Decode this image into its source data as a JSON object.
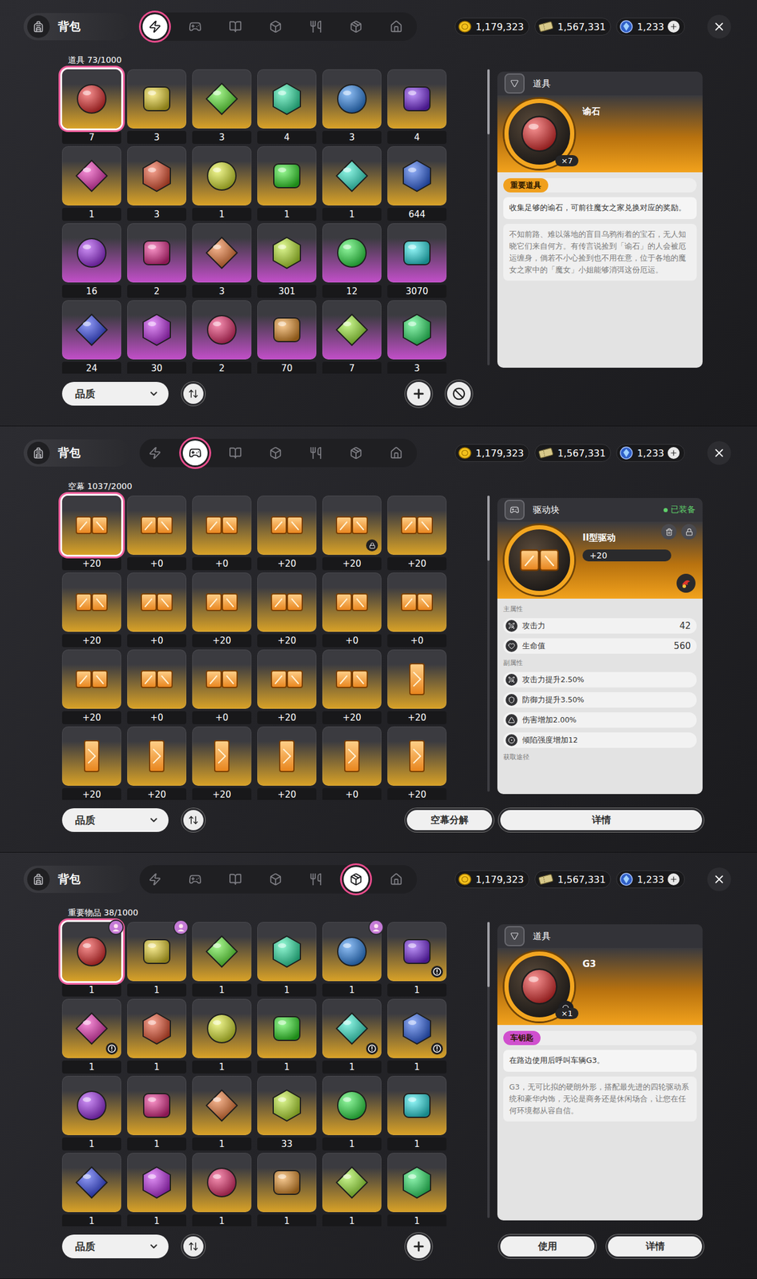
{
  "panels": [
    {
      "header": {
        "title": "背包"
      },
      "tabs": [
        {
          "selected": true
        },
        {
          "selected": false
        },
        {
          "selected": false
        },
        {
          "selected": false
        },
        {
          "selected": false
        },
        {
          "selected": false
        },
        {
          "selected": false
        }
      ],
      "currencies": [
        {
          "amount": "1,179,323",
          "addable": false
        },
        {
          "amount": "1,567,331",
          "addable": false
        },
        {
          "amount": "1,233",
          "addable": true
        }
      ],
      "inventory": {
        "label": "道具 73/1000",
        "items": [
          {
            "count": "7",
            "color": "#d9a227",
            "selected": true
          },
          {
            "count": "3",
            "color": "#d9a227",
            "selected": false
          },
          {
            "count": "3",
            "color": "#d9a227",
            "selected": false
          },
          {
            "count": "4",
            "color": "#d9a227",
            "selected": false
          },
          {
            "count": "3",
            "color": "#d9a227",
            "selected": false
          },
          {
            "count": "4",
            "color": "#d9a227",
            "selected": false
          },
          {
            "count": "1",
            "color": "#d9a227",
            "selected": false
          },
          {
            "count": "3",
            "color": "#d9a227",
            "selected": false
          },
          {
            "count": "1",
            "color": "#d9a227",
            "selected": false
          },
          {
            "count": "1",
            "color": "#d9a227",
            "selected": false
          },
          {
            "count": "1",
            "color": "#d9a227",
            "selected": false
          },
          {
            "count": "644",
            "color": "#d9a227",
            "selected": false
          },
          {
            "count": "16",
            "color": "#c24fc9",
            "selected": false
          },
          {
            "count": "2",
            "color": "#c24fc9",
            "selected": false
          },
          {
            "count": "3",
            "color": "#c24fc9",
            "selected": false
          },
          {
            "count": "301",
            "color": "#c24fc9",
            "selected": false
          },
          {
            "count": "12",
            "color": "#c24fc9",
            "selected": false
          },
          {
            "count": "3070",
            "color": "#c24fc9",
            "selected": false
          },
          {
            "count": "24",
            "color": "#c24fc9",
            "selected": false
          },
          {
            "count": "30",
            "color": "#c24fc9",
            "selected": false
          },
          {
            "count": "2",
            "color": "#c24fc9",
            "selected": false
          },
          {
            "count": "70",
            "color": "#c24fc9",
            "selected": false
          },
          {
            "count": "7",
            "color": "#c24fc9",
            "selected": false
          },
          {
            "count": "3",
            "color": "#c24fc9",
            "selected": false
          }
        ]
      },
      "detail": {
        "kind": "item",
        "category": "道具",
        "name": "谕石",
        "quantity": "×7",
        "tag": "重要道具",
        "tag_color": "#f0a01e",
        "searchable": false,
        "description": "收集足够的谕石，可前往魔女之家兑换对应的奖励。",
        "lore": "不知前路、难以落地的盲目乌鸦衔着的宝石，无人知晓它们来自何方。有传言说捡到「谕石」的人会被厄运缠身，倘若不小心捡到也不用在意，位于各地的魔女之家中的「魔女」小姐能够消弭这份厄运。"
      },
      "bottom": {
        "quality_filter": "品质",
        "tools": [
          {
            "kind": "add"
          },
          {
            "kind": "clear"
          }
        ],
        "buttons": []
      }
    },
    {
      "header": {
        "title": "背包"
      },
      "tabs": [
        {
          "selected": false
        },
        {
          "selected": true
        },
        {
          "selected": false
        },
        {
          "selected": false
        },
        {
          "selected": false
        },
        {
          "selected": false
        },
        {
          "selected": false
        }
      ],
      "currencies": [
        {
          "amount": "1,179,323",
          "addable": false
        },
        {
          "amount": "1,567,331",
          "addable": false
        },
        {
          "amount": "1,233",
          "addable": true
        }
      ],
      "inventory": {
        "label": "空幕 1037/2000",
        "items": [
          {
            "count": "+20",
            "color": "#d9a227",
            "selected": true,
            "kind": "wide",
            "locked": false
          },
          {
            "count": "+0",
            "color": "#d9a227",
            "selected": false,
            "kind": "wide",
            "locked": false
          },
          {
            "count": "+0",
            "color": "#d9a227",
            "selected": false,
            "kind": "wide",
            "locked": false
          },
          {
            "count": "+20",
            "color": "#d9a227",
            "selected": false,
            "kind": "wide",
            "locked": false
          },
          {
            "count": "+20",
            "color": "#d9a227",
            "selected": false,
            "kind": "wide",
            "locked": true
          },
          {
            "count": "+20",
            "color": "#d9a227",
            "selected": false,
            "kind": "wide",
            "locked": false
          },
          {
            "count": "+20",
            "color": "#d9a227",
            "selected": false,
            "kind": "wide",
            "locked": false
          },
          {
            "count": "+0",
            "color": "#d9a227",
            "selected": false,
            "kind": "wide",
            "locked": false
          },
          {
            "count": "+20",
            "color": "#d9a227",
            "selected": false,
            "kind": "wide",
            "locked": false
          },
          {
            "count": "+20",
            "color": "#d9a227",
            "selected": false,
            "kind": "wide",
            "locked": false
          },
          {
            "count": "+0",
            "color": "#d9a227",
            "selected": false,
            "kind": "wide",
            "locked": false
          },
          {
            "count": "+0",
            "color": "#d9a227",
            "selected": false,
            "kind": "wide",
            "locked": false
          },
          {
            "count": "+20",
            "color": "#d9a227",
            "selected": false,
            "kind": "wide",
            "locked": false
          },
          {
            "count": "+0",
            "color": "#d9a227",
            "selected": false,
            "kind": "wide",
            "locked": false
          },
          {
            "count": "+0",
            "color": "#d9a227",
            "selected": false,
            "kind": "wide",
            "locked": false
          },
          {
            "count": "+20",
            "color": "#d9a227",
            "selected": false,
            "kind": "wide",
            "locked": false
          },
          {
            "count": "+20",
            "color": "#d9a227",
            "selected": false,
            "kind": "wide",
            "locked": false
          },
          {
            "count": "+20",
            "color": "#d9a227",
            "selected": false,
            "kind": "tall",
            "locked": false
          },
          {
            "count": "+20",
            "color": "#d9a227",
            "selected": false,
            "kind": "tall",
            "locked": false
          },
          {
            "count": "+20",
            "color": "#d9a227",
            "selected": false,
            "kind": "tall",
            "locked": false
          },
          {
            "count": "+20",
            "color": "#d9a227",
            "selected": false,
            "kind": "tall",
            "locked": false
          },
          {
            "count": "+20",
            "color": "#d9a227",
            "selected": false,
            "kind": "tall",
            "locked": false
          },
          {
            "count": "+0",
            "color": "#d9a227",
            "selected": false,
            "kind": "tall",
            "locked": false
          },
          {
            "count": "+20",
            "color": "#d9a227",
            "selected": false,
            "kind": "tall",
            "locked": false
          }
        ]
      },
      "detail": {
        "kind": "disc",
        "category": "驱动块",
        "status": "已装备",
        "name": "II型驱动",
        "level": "+20",
        "main_label": "主属性",
        "main_stats": [
          {
            "label": "攻击力",
            "value": "42"
          },
          {
            "label": "生命值",
            "value": "560"
          }
        ],
        "sub_label": "副属性",
        "sub_stats": [
          {
            "label": "攻击力提升2.50%"
          },
          {
            "label": "防御力提升3.50%"
          },
          {
            "label": "伤害增加2.00%"
          },
          {
            "label": "倾陷强度增加12"
          }
        ],
        "source_label": "获取途径"
      },
      "bottom": {
        "quality_filter": "品质",
        "tools": [
          {
            "kind": "text",
            "label": "空幕分解"
          }
        ],
        "buttons": [
          "详情"
        ]
      }
    },
    {
      "header": {
        "title": "背包"
      },
      "tabs": [
        {
          "selected": false
        },
        {
          "selected": false
        },
        {
          "selected": false
        },
        {
          "selected": false
        },
        {
          "selected": false
        },
        {
          "selected": true
        },
        {
          "selected": false
        }
      ],
      "currencies": [
        {
          "amount": "1,179,323",
          "addable": false
        },
        {
          "amount": "1,567,331",
          "addable": false
        },
        {
          "amount": "1,233",
          "addable": true
        }
      ],
      "inventory": {
        "label": "重要物品 38/1000",
        "items": [
          {
            "count": "1",
            "color": "#d9a227",
            "selected": true,
            "badge": "avatar"
          },
          {
            "count": "1",
            "color": "#d9a227",
            "selected": false,
            "badge": "avatar"
          },
          {
            "count": "1",
            "color": "#d9a227",
            "selected": false,
            "badge": "none"
          },
          {
            "count": "1",
            "color": "#d9a227",
            "selected": false,
            "badge": "none"
          },
          {
            "count": "1",
            "color": "#d9a227",
            "selected": false,
            "badge": "avatar"
          },
          {
            "count": "1",
            "color": "#d9a227",
            "selected": false,
            "badge": "alert"
          },
          {
            "count": "1",
            "color": "#d9a227",
            "selected": false,
            "badge": "alert"
          },
          {
            "count": "1",
            "color": "#d9a227",
            "selected": false,
            "badge": "none"
          },
          {
            "count": "1",
            "color": "#d9a227",
            "selected": false,
            "badge": "none"
          },
          {
            "count": "1",
            "color": "#d9a227",
            "selected": false,
            "badge": "none"
          },
          {
            "count": "1",
            "color": "#d9a227",
            "selected": false,
            "badge": "alert"
          },
          {
            "count": "1",
            "color": "#d9a227",
            "selected": false,
            "badge": "alert"
          },
          {
            "count": "1",
            "color": "#d9a227",
            "selected": false,
            "badge": "none"
          },
          {
            "count": "1",
            "color": "#d9a227",
            "selected": false,
            "badge": "none"
          },
          {
            "count": "1",
            "color": "#d9a227",
            "selected": false,
            "badge": "none"
          },
          {
            "count": "33",
            "color": "#d9a227",
            "selected": false,
            "badge": "none"
          },
          {
            "count": "1",
            "color": "#d9a227",
            "selected": false,
            "badge": "none"
          },
          {
            "count": "1",
            "color": "#d9a227",
            "selected": false,
            "badge": "none"
          },
          {
            "count": "1",
            "color": "#d9a227",
            "selected": false,
            "badge": "none"
          },
          {
            "count": "1",
            "color": "#d9a227",
            "selected": false,
            "badge": "none"
          },
          {
            "count": "1",
            "color": "#d9a227",
            "selected": false,
            "badge": "none"
          },
          {
            "count": "1",
            "color": "#d9a227",
            "selected": false,
            "badge": "none"
          },
          {
            "count": "1",
            "color": "#d9a227",
            "selected": false,
            "badge": "none"
          },
          {
            "count": "1",
            "color": "#d9a227",
            "selected": false,
            "badge": "none"
          }
        ]
      },
      "detail": {
        "kind": "item",
        "category": "道具",
        "name": "G3",
        "quantity": "×1",
        "tag": "车钥匙",
        "tag_color": "#d04fce",
        "searchable": true,
        "description": "在路边使用后呼叫车辆G3。",
        "lore": "G3，无可比拟的硬朗外形，搭配最先进的四轮驱动系统和豪华内饰，无论是商务还是休闲场合，让您在任何环境都从容自信。"
      },
      "bottom": {
        "quality_filter": "品质",
        "tools": [
          {
            "kind": "add"
          }
        ],
        "buttons": [
          "使用",
          "详情"
        ]
      }
    }
  ]
}
